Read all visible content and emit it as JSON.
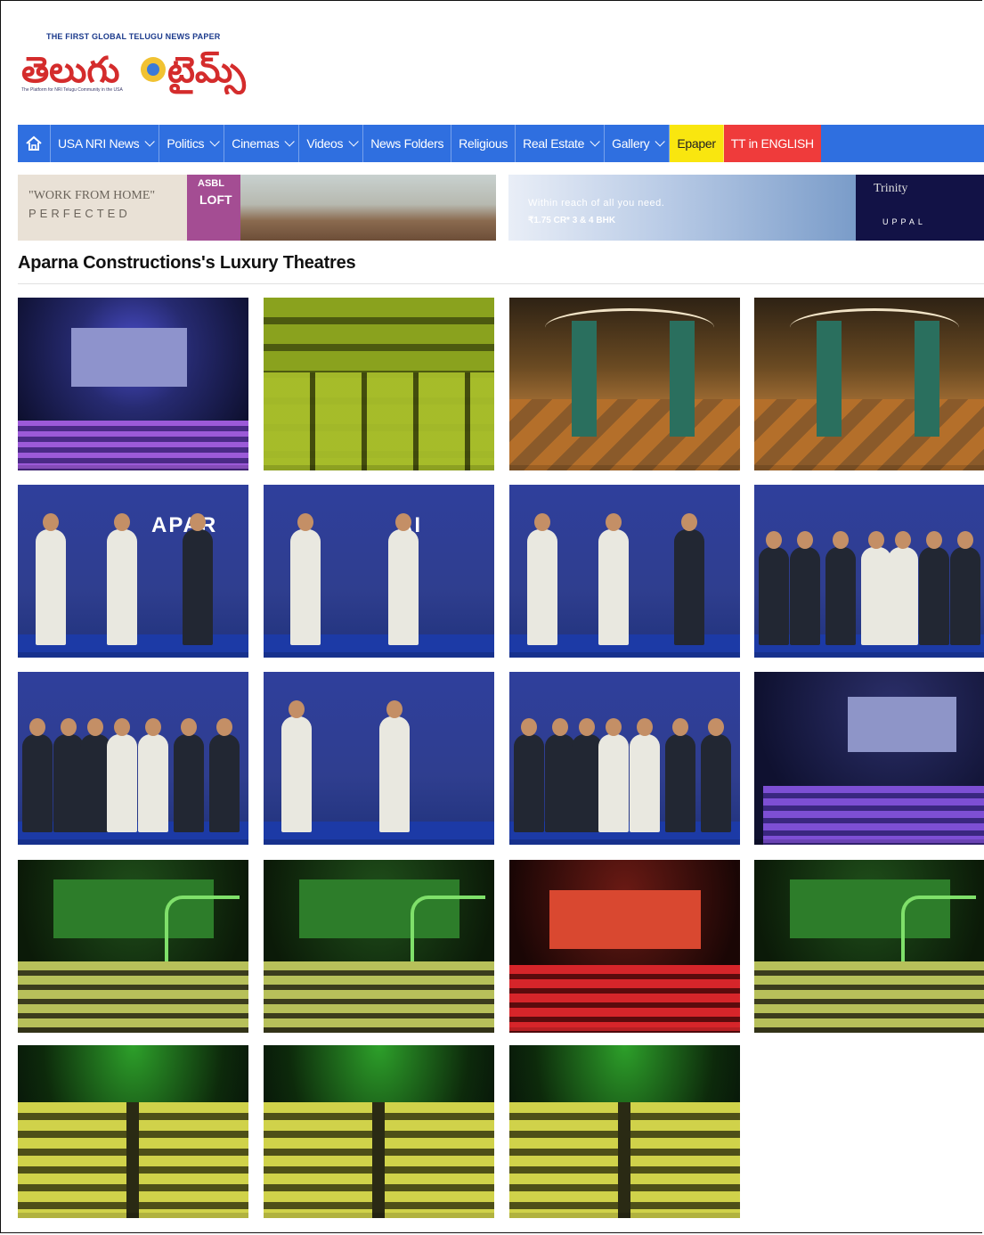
{
  "logo": {
    "tagline": "THE FIRST GLOBAL TELUGU NEWS PAPER",
    "name_telugu": "తెలుగు టైమ్స్",
    "subline": "The Platform for NRI Telugu Community in the USA"
  },
  "nav": {
    "items": [
      {
        "label": "USA NRI News",
        "dropdown": true
      },
      {
        "label": "Politics",
        "dropdown": true
      },
      {
        "label": "Cinemas",
        "dropdown": true
      },
      {
        "label": "Videos",
        "dropdown": true
      },
      {
        "label": "News Folders",
        "dropdown": false
      },
      {
        "label": "Religious",
        "dropdown": false
      },
      {
        "label": "Real Estate",
        "dropdown": true
      },
      {
        "label": "Gallery",
        "dropdown": true
      }
    ],
    "epaper": "Epaper",
    "english": "TT in ENGLISH",
    "colors": {
      "bar": "#2f6fe0",
      "epaper": "#f9e60f",
      "english": "#ef3b3b"
    }
  },
  "banners": {
    "left": {
      "line1": "\"WORK FROM HOME\"",
      "line2": "PERFECTED",
      "brand_top": "ASBL",
      "brand_bottom": "LOFT"
    },
    "right": {
      "line1": "Within reach of all you need.",
      "price": "₹1.75 CR*  3 & 4 BHK",
      "brand": "Trinity",
      "location": "UPPAL"
    }
  },
  "page": {
    "title": "Aparna Constructions's Luxury Theatres"
  },
  "gallery": {
    "images": [
      {
        "kind": "dark-theatre"
      },
      {
        "kind": "yellow-seats"
      },
      {
        "kind": "lobby"
      },
      {
        "kind": "lobby"
      },
      {
        "kind": "people",
        "text": "APAR"
      },
      {
        "kind": "people",
        "text": "AI"
      },
      {
        "kind": "people",
        "text": ""
      },
      {
        "kind": "people",
        "text": ""
      },
      {
        "kind": "people",
        "text": ""
      },
      {
        "kind": "people",
        "text": ""
      },
      {
        "kind": "people",
        "text": ""
      },
      {
        "kind": "purple-theatre"
      },
      {
        "kind": "green-theatre"
      },
      {
        "kind": "green-theatre"
      },
      {
        "kind": "red-theatre"
      },
      {
        "kind": "green-theatre"
      },
      {
        "kind": "green-hall"
      },
      {
        "kind": "green-hall"
      },
      {
        "kind": "green-hall"
      }
    ]
  }
}
